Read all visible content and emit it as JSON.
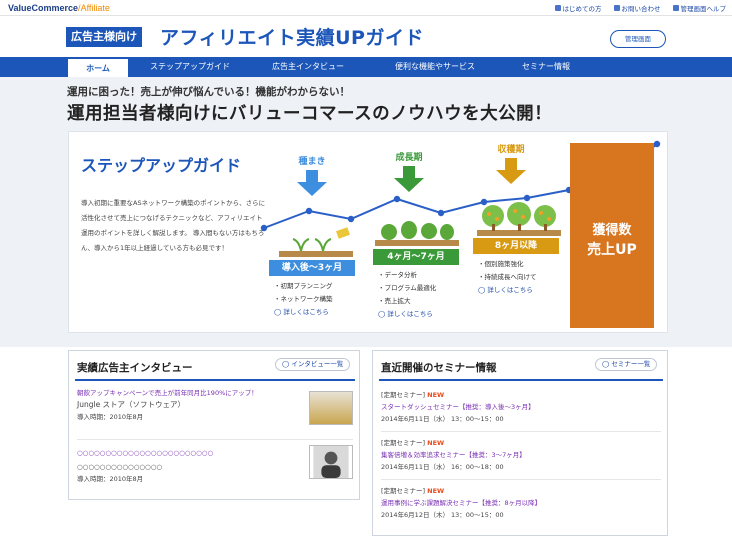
{
  "brand": {
    "name": "ValueCommerce",
    "sub": "Affiliate"
  },
  "top_links": [
    {
      "label": "はじめての方",
      "icon": "beginner-icon"
    },
    {
      "label": "お問い合わせ",
      "icon": "mail-icon"
    },
    {
      "label": "管理画面ヘルプ",
      "icon": "help-icon"
    }
  ],
  "header": {
    "badge": "広告主様向け",
    "title": "アフィリエイト実績UPガイド",
    "admin_button": "管理画面"
  },
  "nav": {
    "tabs": [
      "ホーム",
      "ステップアップガイド",
      "広告主インタビュー",
      "便利な機能やサービス",
      "セミナー情報"
    ],
    "active": "ホーム"
  },
  "lead": {
    "line1": "運用に困った！売上が伸び悩んでいる！機能がわからない！",
    "line2": "運用担当者様向けにバリューコマースのノウハウを大公開！"
  },
  "guide": {
    "title": "ステップアップガイド",
    "description": "導入初期に重要なASネットワーク構築のポイントから、さらに活性化させて売上につなげるテクニックなど、アフィリエイト運用のポイントを詳しく解説します。 導入間もない方はもちろん、導入から1年以上経過している方も必見です！",
    "stages": [
      {
        "name": "種まき",
        "period": "導入後〜3ヶ月",
        "items": [
          "初期プランニング",
          "ネットワーク構築"
        ],
        "more": "詳しくはこちら",
        "color": "#3d8ede"
      },
      {
        "name": "成長期",
        "period": "4ヶ月〜7ヶ月",
        "items": [
          "データ分析",
          "プログラム最適化",
          "売上拡大"
        ],
        "more": "詳しくはこちら",
        "color": "#3a9a3a"
      },
      {
        "name": "収穫期",
        "period": "8ヶ月以降",
        "items": [
          "個別施策強化",
          "持続成長へ向けて"
        ],
        "more": "詳しくはこちら",
        "color": "#d89a12"
      }
    ],
    "result": {
      "line1": "獲得数",
      "line2": "売上UP"
    }
  },
  "interview": {
    "title": "実績広告主インタビュー",
    "button": "インタビュー一覧",
    "items": [
      {
        "title": "朝飲アップキャンペーンで売上が前年同月比190%にアップ！",
        "company": "Jungle ストア（ソフトウェア）",
        "date": "導入時期：2010年8月"
      },
      {
        "title": "○○○○○○○○○○○○○○○○○○○○○○○○",
        "company": "○○○○○○○○○○○○○○○",
        "date": "導入時期：2010年8月"
      }
    ]
  },
  "seminar": {
    "title": "直近開催のセミナー情報",
    "button": "セミナー一覧",
    "items": [
      {
        "label": "[定期セミナー]",
        "new": "NEW",
        "title": "スタートダッシュセミナー【推奨：導入後〜3ヶ月】",
        "date": "2014年6月11日（水） 13：00〜15：00"
      },
      {
        "label": "[定期セミナー]",
        "new": "NEW",
        "title": "集客倍増＆効率追求セミナー【推奨：3〜7ヶ月】",
        "date": "2014年6月11日（水） 16：00〜18：00"
      },
      {
        "label": "[定期セミナー]",
        "new": "NEW",
        "title": "運用事例に学ぶ課題解決セミナー【推奨：8ヶ月以降】",
        "date": "2014年6月12日（木） 13：00〜15：00"
      }
    ]
  }
}
